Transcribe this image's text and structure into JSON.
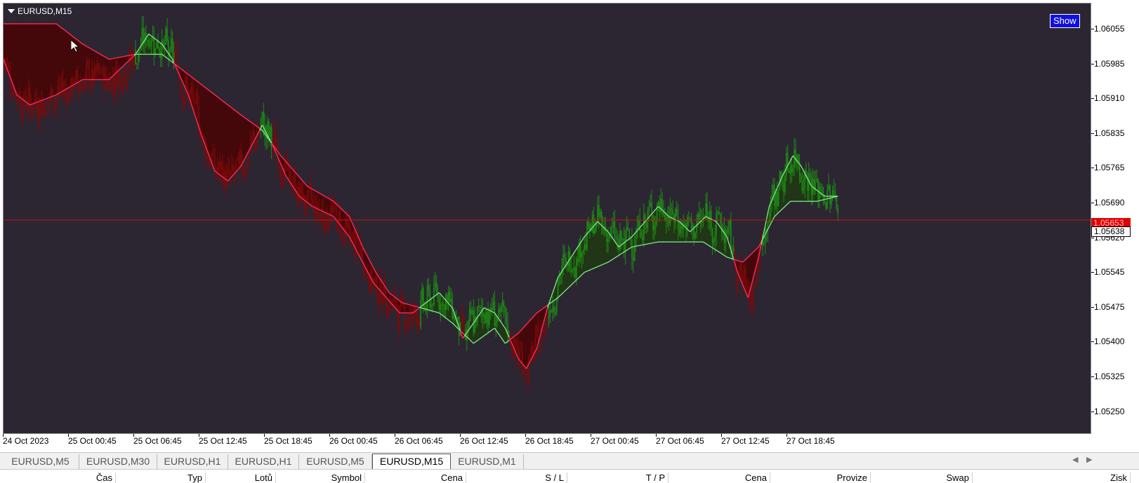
{
  "chart": {
    "title": "EURUSD,M15",
    "show_button": "Show",
    "current_price": "1.05638",
    "bid_price": "1.05653"
  },
  "colors": {
    "background": "#2b2632",
    "bull": "#1e8a14",
    "bear": "#7a0a0a",
    "fast_line_up": "#7de08a",
    "slow_line": "#ff2a5a",
    "cloud_up": "#1e3a12",
    "cloud_down": "#4a0404",
    "price_line": "#d01010"
  },
  "price_axis": {
    "labels": [
      "1.06055",
      "1.05985",
      "1.05910",
      "1.05835",
      "1.05765",
      "1.05690",
      "1.05620",
      "1.05545",
      "1.05475",
      "1.05400",
      "1.05325",
      "1.05250"
    ],
    "min": 1.0523,
    "max": 1.0608
  },
  "time_axis": {
    "labels": [
      "24 Oct 2023",
      "25 Oct 00:45",
      "25 Oct 06:45",
      "25 Oct 12:45",
      "25 Oct 18:45",
      "26 Oct 00:45",
      "26 Oct 06:45",
      "26 Oct 12:45",
      "26 Oct 18:45",
      "27 Oct 00:45",
      "27 Oct 06:45",
      "27 Oct 12:45",
      "27 Oct 18:45"
    ]
  },
  "tabs": [
    {
      "label": "EURUSD,M5",
      "active": false
    },
    {
      "label": "EURUSD,M30",
      "active": false
    },
    {
      "label": "EURUSD,H1",
      "active": false
    },
    {
      "label": "EURUSD,H1",
      "active": false
    },
    {
      "label": "EURUSD,M5",
      "active": false
    },
    {
      "label": "EURUSD,M15",
      "active": true
    },
    {
      "label": "EURUSD,M1",
      "active": false
    }
  ],
  "tab_scroll": {
    "left": "◀",
    "right": "▶"
  },
  "terminal_columns": [
    "Čas",
    "Typ",
    "Lotů",
    "Symbol",
    "Cena",
    "S / L",
    "T / P",
    "Cena",
    "Provize",
    "Swap",
    "Zisk"
  ],
  "chart_data": {
    "type": "candlestick",
    "symbol": "EURUSD",
    "timeframe": "M15",
    "ylim": [
      1.0523,
      1.0608
    ],
    "current_price": 1.05653,
    "fast_ma": [
      [
        0,
        1.0597
      ],
      [
        10,
        1.059
      ],
      [
        20,
        1.0588
      ],
      [
        40,
        1.059
      ],
      [
        60,
        1.0593
      ],
      [
        80,
        1.0593
      ],
      [
        100,
        1.0598
      ],
      [
        110,
        1.0602
      ],
      [
        120,
        1.06
      ],
      [
        128,
        1.0597
      ],
      [
        140,
        1.059
      ],
      [
        150,
        1.0582
      ],
      [
        160,
        1.0575
      ],
      [
        170,
        1.0573
      ],
      [
        180,
        1.0576
      ],
      [
        190,
        1.0581
      ],
      [
        196,
        1.0584
      ],
      [
        204,
        1.058
      ],
      [
        214,
        1.0574
      ],
      [
        224,
        1.057
      ],
      [
        234,
        1.0568
      ],
      [
        250,
        1.0566
      ],
      [
        262,
        1.0562
      ],
      [
        270,
        1.0558
      ],
      [
        280,
        1.0553
      ],
      [
        290,
        1.055
      ],
      [
        300,
        1.0547
      ],
      [
        310,
        1.0547
      ],
      [
        320,
        1.0549
      ],
      [
        330,
        1.0551
      ],
      [
        340,
        1.0548
      ],
      [
        348,
        1.0542
      ],
      [
        356,
        1.0545
      ],
      [
        364,
        1.0548
      ],
      [
        372,
        1.0547
      ],
      [
        380,
        1.0544
      ],
      [
        390,
        1.0538
      ],
      [
        396,
        1.0536
      ],
      [
        404,
        1.054
      ],
      [
        412,
        1.0548
      ],
      [
        420,
        1.0554
      ],
      [
        430,
        1.0558
      ],
      [
        440,
        1.0562
      ],
      [
        450,
        1.0565
      ],
      [
        458,
        1.0563
      ],
      [
        466,
        1.056
      ],
      [
        476,
        1.0562
      ],
      [
        486,
        1.0565
      ],
      [
        496,
        1.0568
      ],
      [
        504,
        1.0566
      ],
      [
        512,
        1.0565
      ],
      [
        520,
        1.0563
      ],
      [
        532,
        1.0566
      ],
      [
        540,
        1.0565
      ],
      [
        548,
        1.0562
      ],
      [
        556,
        1.0555
      ],
      [
        564,
        1.055
      ],
      [
        572,
        1.0558
      ],
      [
        580,
        1.0568
      ],
      [
        590,
        1.0574
      ],
      [
        598,
        1.0578
      ],
      [
        604,
        1.0576
      ],
      [
        612,
        1.0572
      ],
      [
        622,
        1.057
      ],
      [
        632,
        1.057
      ]
    ],
    "slow_ma": [
      [
        0,
        1.0604
      ],
      [
        20,
        1.0604
      ],
      [
        40,
        1.0604
      ],
      [
        60,
        1.06
      ],
      [
        80,
        1.0597
      ],
      [
        100,
        1.0598
      ],
      [
        120,
        1.0598
      ],
      [
        140,
        1.0594
      ],
      [
        160,
        1.059
      ],
      [
        180,
        1.0586
      ],
      [
        196,
        1.0583
      ],
      [
        210,
        1.0578
      ],
      [
        230,
        1.0572
      ],
      [
        250,
        1.0569
      ],
      [
        262,
        1.0566
      ],
      [
        272,
        1.056
      ],
      [
        282,
        1.0555
      ],
      [
        292,
        1.0551
      ],
      [
        302,
        1.0549
      ],
      [
        316,
        1.0548
      ],
      [
        330,
        1.0547
      ],
      [
        340,
        1.0545
      ],
      [
        356,
        1.0541
      ],
      [
        372,
        1.0544
      ],
      [
        380,
        1.0541
      ],
      [
        390,
        1.0543
      ],
      [
        404,
        1.0547
      ],
      [
        420,
        1.055
      ],
      [
        440,
        1.0555
      ],
      [
        458,
        1.0557
      ],
      [
        476,
        1.056
      ],
      [
        496,
        1.0561
      ],
      [
        512,
        1.0561
      ],
      [
        530,
        1.0561
      ],
      [
        548,
        1.0558
      ],
      [
        560,
        1.0557
      ],
      [
        572,
        1.056
      ],
      [
        584,
        1.0566
      ],
      [
        596,
        1.0569
      ],
      [
        616,
        1.0569
      ],
      [
        632,
        1.057
      ]
    ],
    "candles_generated_from_smoothed_path": true
  }
}
